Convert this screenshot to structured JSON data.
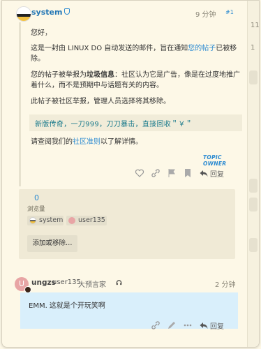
{
  "post1": {
    "username": "system",
    "time": "9 分钟",
    "post_number": "#1",
    "greeting": "您好，",
    "para1_prefix": "这是一封由 LINUX DO 自动发送的邮件，旨在通知",
    "para1_link": "您的帖子",
    "para1_suffix": "已被移除。",
    "para2_prefix": "您的帖子被举报为",
    "para2_bold": "垃圾信息",
    "para2_suffix": "：社区认为它是广告，像是在过度地推广着什么，而不是预期中与话题有关的内容。",
    "para3": "此帖子被社区举报，管理人员选择将其移除。",
    "quoted": "新版传奇，一刀999，刀刀暴击，直接回收＂￥＂",
    "para4_prefix": "请查阅我们的",
    "para4_link": "社区准则",
    "para4_suffix": "以了解详情。",
    "topic_owner": "TOPIC OWNER",
    "reply_label": "回复"
  },
  "stats": {
    "views": "0",
    "views_label": "浏览量",
    "participants": [
      "system",
      "user135"
    ],
    "add_remove_label": "添加或移除…"
  },
  "post2": {
    "avatar_letter": "U",
    "username": "ungzs",
    "handle": "user135",
    "title": "大预言家",
    "time": "2 分钟",
    "body": "EMM. 这就是个开玩笑啊",
    "reply_label": "回复"
  },
  "sidebar": {
    "numbers": [
      "11",
      "1"
    ]
  },
  "colors": {
    "background": "#fdf8e7",
    "link": "#2b8ad1",
    "reply_bg": "#d9effb"
  }
}
